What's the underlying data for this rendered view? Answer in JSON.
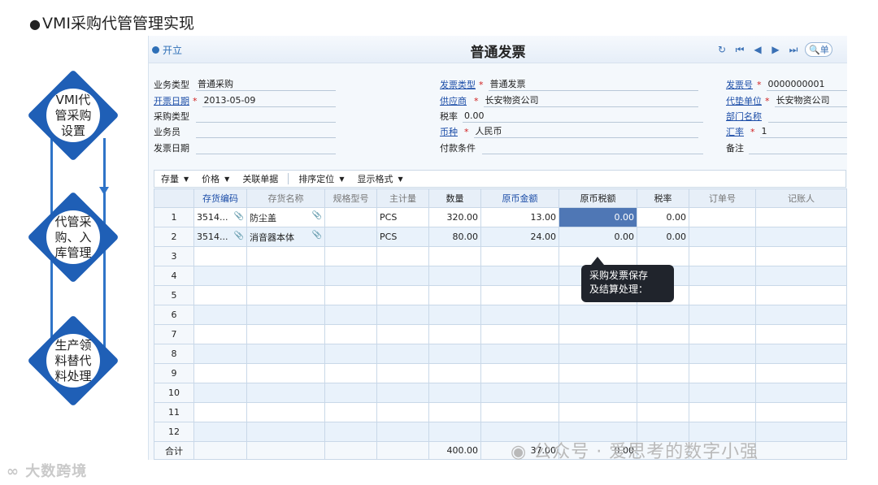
{
  "slide_title": "VMI采购代管管理实现",
  "flow": {
    "steps": [
      "VMI代管采购设置",
      "代管采购、入库管理",
      "生产领料替代料处理"
    ],
    "step_lines": [
      [
        "VMI代",
        "管采购",
        "设置"
      ],
      [
        "代管采",
        "购、入",
        "库管理"
      ],
      [
        "生产领",
        "料替代",
        "料处理"
      ]
    ]
  },
  "window": {
    "open_label": "开立",
    "title": "普通发票",
    "search_placeholder": "单"
  },
  "form": {
    "col1": [
      {
        "label": "业务类型",
        "value": "普通采购",
        "link": false,
        "required": false
      },
      {
        "label": "开票日期",
        "value": "2013-05-09",
        "link": true,
        "required": true
      },
      {
        "label": "采购类型",
        "value": "",
        "link": false,
        "required": false
      },
      {
        "label": "业务员",
        "value": "",
        "link": false,
        "required": false
      },
      {
        "label": "发票日期",
        "value": "",
        "link": false,
        "required": false
      }
    ],
    "col2": [
      {
        "label": "发票类型",
        "value": "普通发票",
        "link": true,
        "required": true
      },
      {
        "label": "供应商",
        "value": "长安物资公司",
        "link": true,
        "required": true
      },
      {
        "label": "税率",
        "value": "0.00",
        "link": false,
        "required": false
      },
      {
        "label": "币种",
        "value": "人民币",
        "link": true,
        "required": true
      },
      {
        "label": "付款条件",
        "value": "",
        "link": false,
        "required": false
      }
    ],
    "col3": [
      {
        "label": "发票号",
        "value": "0000000001",
        "link": true,
        "required": true
      },
      {
        "label": "代垫单位",
        "value": "长安物资公司",
        "link": true,
        "required": true
      },
      {
        "label": "部门名称",
        "value": "",
        "link": true,
        "required": false
      },
      {
        "label": "汇率",
        "value": "1",
        "link": true,
        "required": true
      },
      {
        "label": "备注",
        "value": "",
        "link": false,
        "required": false
      }
    ]
  },
  "toolbar": {
    "items": [
      "存量",
      "价格",
      "关联单据",
      "排序定位",
      "显示格式"
    ]
  },
  "grid": {
    "headers": [
      "",
      "存货编码",
      "存货名称",
      "规格型号",
      "主计量",
      "数量",
      "原币金额",
      "原币税额",
      "税率",
      "订单号",
      "记账人"
    ],
    "rows": [
      {
        "no": "1",
        "code": "3514...",
        "name": "防尘盖",
        "spec": "",
        "unit": "PCS",
        "qty": "320.00",
        "amount": "13.00",
        "tax": "0.00",
        "rate": "0.00"
      },
      {
        "no": "2",
        "code": "3514...",
        "name": "消音器本体",
        "spec": "",
        "unit": "PCS",
        "qty": "80.00",
        "amount": "24.00",
        "tax": "0.00",
        "rate": "0.00"
      }
    ],
    "empty_rows": [
      "3",
      "4",
      "5",
      "6",
      "7",
      "8",
      "9",
      "10",
      "11",
      "12"
    ],
    "total": {
      "label": "合计",
      "qty": "400.00",
      "amount": "37.00",
      "tax": "0.00"
    }
  },
  "tooltip": {
    "line1": "采购发票保存",
    "line2": "及结算处理："
  },
  "watermarks": {
    "left": "大数跨境",
    "right": "公众号 · 爱思考的数字小强"
  },
  "colors": {
    "accent": "#1f5fb6",
    "link": "#1d4ea8",
    "selected_cell": "#4f77b5"
  }
}
